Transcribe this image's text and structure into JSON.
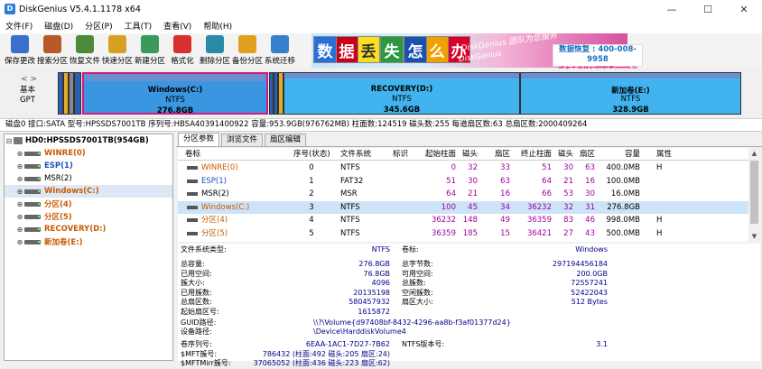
{
  "window": {
    "title": "DiskGenius V5.4.1.1178 x64",
    "app_icon": "D"
  },
  "menu": [
    "文件(F)",
    "磁盘(D)",
    "分区(P)",
    "工具(T)",
    "查看(V)",
    "帮助(H)"
  ],
  "toolbar": [
    {
      "label": "保存更改",
      "icon": "save-icon",
      "color": "#3a6fcf"
    },
    {
      "label": "搜索分区",
      "icon": "search-icon",
      "color": "#b65a2a"
    },
    {
      "label": "恢复文件",
      "icon": "recover-icon",
      "color": "#4a8a3a"
    },
    {
      "label": "快速分区",
      "icon": "quick-partition-icon",
      "color": "#d8a020"
    },
    {
      "label": "新建分区",
      "icon": "new-partition-icon",
      "color": "#3a9a5a"
    },
    {
      "label": "格式化",
      "icon": "format-icon",
      "color": "#d83030"
    },
    {
      "label": "删除分区",
      "icon": "delete-icon",
      "color": "#2a8aa8"
    },
    {
      "label": "备份分区",
      "icon": "backup-icon",
      "color": "#e0a020"
    },
    {
      "label": "系统迁移",
      "icon": "migrate-icon",
      "color": "#3a7fcf"
    }
  ],
  "banner": {
    "chars": [
      "数",
      "据",
      "丢",
      "失",
      "怎",
      "么",
      "办"
    ],
    "char_colors": [
      "#2a6fd8",
      "#c8001a",
      "#f8e020",
      "#2a9a40",
      "#1a50b0",
      "#f0a000",
      "#d8002a"
    ],
    "slogan": "DiskGenius 团队为您服务",
    "name": "DiskGenius",
    "phone": "数据恢复 : 400-008-9958",
    "phone_sub": "或点击此处扫码联系QQ咨询"
  },
  "disk": {
    "type_label": "基本",
    "type_label2": "GPT",
    "nav_left": "<",
    "nav_right": ">",
    "partitions": [
      {
        "name": "Windows(C:)",
        "fs": "NTFS",
        "size": "276.8GB",
        "color": "#3a96e0",
        "selected": true
      },
      {
        "name": "RECOVERY(D:)",
        "fs": "NTFS",
        "size": "345.6GB",
        "color": "#41b4f0"
      },
      {
        "name": "新加卷(E:)",
        "fs": "NTFS",
        "size": "328.9GB",
        "color": "#41b4f0"
      }
    ]
  },
  "disk_info": "磁盘0 接口:SATA  型号:HPSSDS7001TB  序列号:HBSA40391400922  容量:953.9GB(976762MB)  柱面数:124519  磁头数:255  每道扇区数:63  总扇区数:2000409264",
  "tree": {
    "disk": "HD0:HPSSDS7001TB(954GB)",
    "items": [
      {
        "label": "WINRE(0)",
        "color": "#c85a00"
      },
      {
        "label": "ESP(1)",
        "color": "#1a50c0"
      },
      {
        "label": "MSR(2)",
        "color": "#000000"
      },
      {
        "label": "Windows(C:)",
        "color": "#c85a00",
        "selected": true
      },
      {
        "label": "分区(4)",
        "color": "#c85a00"
      },
      {
        "label": "分区(5)",
        "color": "#c85a00"
      },
      {
        "label": "RECOVERY(D:)",
        "color": "#c85a00"
      },
      {
        "label": "新加卷(E:)",
        "color": "#c85a00"
      }
    ]
  },
  "tabs": [
    "分区参数",
    "浏览文件",
    "扇区编辑"
  ],
  "table": {
    "headers": [
      "卷标",
      "序号(状态)",
      "文件系统",
      "标识",
      "起始柱面",
      "磁头",
      "扇区",
      "终止柱面",
      "磁头",
      "扇区",
      "容量",
      "属性"
    ],
    "rows": [
      {
        "label": "WINRE(0)",
        "color": "#c85a00",
        "cells": [
          "0",
          "NTFS",
          "",
          "0",
          "32",
          "33",
          "51",
          "30",
          "63",
          "400.0MB",
          "H"
        ]
      },
      {
        "label": "ESP(1)",
        "color": "#1a50c0",
        "cells": [
          "1",
          "FAT32",
          "",
          "51",
          "30",
          "63",
          "64",
          "21",
          "16",
          "100.0MB",
          ""
        ]
      },
      {
        "label": "MSR(2)",
        "color": "#000000",
        "cells": [
          "2",
          "MSR",
          "",
          "64",
          "21",
          "16",
          "66",
          "53",
          "30",
          "16.0MB",
          ""
        ]
      },
      {
        "label": "Windows(C:)",
        "color": "#c85a00",
        "cells": [
          "3",
          "NTFS",
          "",
          "100",
          "45",
          "34",
          "36232",
          "32",
          "31",
          "276.8GB",
          ""
        ],
        "selected": true
      },
      {
        "label": "分区(4)",
        "color": "#c85a00",
        "cells": [
          "4",
          "NTFS",
          "",
          "36232",
          "148",
          "49",
          "36359",
          "83",
          "46",
          "998.0MB",
          "H"
        ]
      },
      {
        "label": "分区(5)",
        "color": "#c85a00",
        "cells": [
          "5",
          "NTFS",
          "",
          "36359",
          "185",
          "15",
          "36421",
          "27",
          "43",
          "500.0MB",
          "H"
        ]
      }
    ]
  },
  "details": {
    "fs_type_label": "文件系统类型:",
    "fs_type": "NTFS",
    "vol_label_label": "卷标:",
    "vol_label": "Windows",
    "rows": [
      {
        "l1": "总容量:",
        "v1": "276.8GB",
        "l2": "总字节数:",
        "v2": "297194456184"
      },
      {
        "l1": "已用空间:",
        "v1": "76.8GB",
        "l2": "可用空间:",
        "v2": "200.0GB"
      },
      {
        "l1": "簇大小:",
        "v1": "4096",
        "l2": "总簇数:",
        "v2": "72557241"
      },
      {
        "l1": "已用簇数:",
        "v1": "20135198",
        "l2": "空闲簇数:",
        "v2": "52422043"
      },
      {
        "l1": "总扇区数:",
        "v1": "580457932",
        "l2": "扇区大小:",
        "v2": "512 Bytes"
      },
      {
        "l1": "起始扇区号:",
        "v1": "1615872",
        "l2": "",
        "v2": ""
      }
    ],
    "guid_label": "GUID路径:",
    "guid": "\\\\?\\Volume{d97408bf-8432-4296-aa8b-f3af01377d24}",
    "device_label": "设备路径:",
    "device": "\\Device\\HarddiskVolume4",
    "rows2": [
      {
        "l1": "卷序列号:",
        "v1": "6EAA-1AC1-7D27-7B62",
        "l2": "NTFS版本号:",
        "v2": "3.1"
      },
      {
        "l1": "$MFT簇号:",
        "v1": "786432 (柱面:492 磁头:205 扇区:24)",
        "l2": "",
        "v2": ""
      },
      {
        "l1": "$MFTMirr簇号:",
        "v1": "37065052 (柱面:436 磁头:223 扇区:62)",
        "l2": "",
        "v2": ""
      }
    ]
  }
}
